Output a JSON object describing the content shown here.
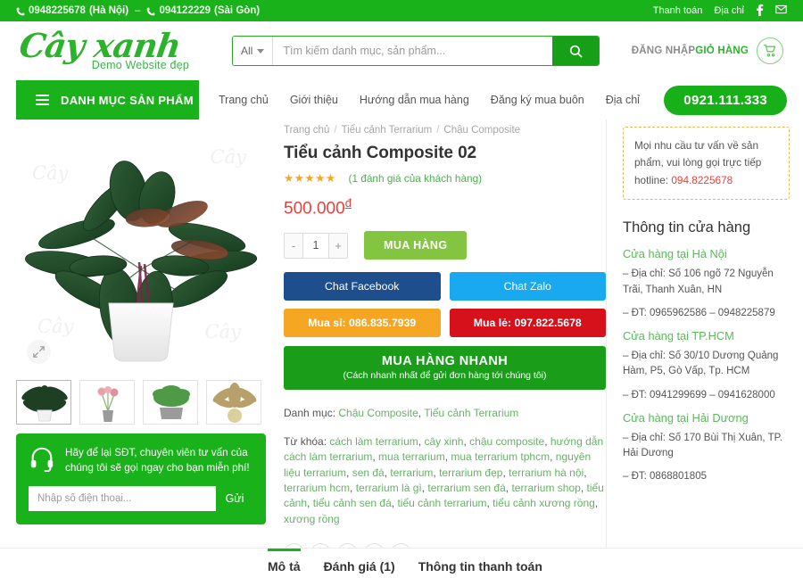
{
  "topbar": {
    "phone1": "0948225678",
    "loc1": "(Hà Nội)",
    "dash": "–",
    "phone2": "094122229",
    "loc2": "(Sài Gòn)",
    "links": [
      "Thanh toán",
      "Địa chỉ"
    ],
    "icons": [
      "facebook-icon",
      "mail-icon"
    ]
  },
  "header": {
    "logo_text": "Cây xanh",
    "logo_sub": "Demo Website đẹp",
    "search": {
      "category": "All",
      "placeholder": "Tìm kiếm danh mục, sản phẩm...",
      "value": ""
    },
    "login_label": "ĐĂNG NHẬP",
    "cart_label": "GIỎ HÀNG"
  },
  "nav": {
    "category_button": "DANH MỤC SẢN PHẨM",
    "links": [
      "Trang chủ",
      "Giới thiệu",
      "Hướng dẫn mua hàng",
      "Đăng ký mua buôn",
      "Địa chỉ"
    ],
    "hotline": "0921.111.333"
  },
  "product": {
    "breadcrumb": [
      "Trang chủ",
      "Tiểu cảnh Terrarium",
      "Chậu Composite"
    ],
    "title": "Tiểu cảnh Composite 02",
    "stars": "★★★★★",
    "review_link": "(1 đánh giá của khách hàng)",
    "price": "500.000",
    "currency": "đ",
    "qty_minus": "-",
    "qty_value": "1",
    "qty_plus": "+",
    "buy_label": "MUA HÀNG",
    "chat_facebook": "Chat Facebook",
    "chat_zalo": "Chat Zalo",
    "mua_si": "Mua sỉ: 086.835.7939",
    "mua_le": "Mua lẻ: 097.822.5678",
    "fast_title": "MUA HÀNG NHANH",
    "fast_sub": "(Cách nhanh nhất để gửi đơn hàng tới chúng tôi)",
    "category_label": "Danh mục:",
    "categories": [
      "Chậu Composite",
      "Tiểu cảnh Terrarium"
    ],
    "tags_label": "Từ khóa:",
    "tags": [
      "cách làm terrarium",
      "cây xinh",
      "chậu composite",
      "hướng dẫn cách làm terrarium",
      "mua terrarium",
      "mua terrarium tphcm",
      "nguyên liệu terrarium",
      "sen đá",
      "terrarium",
      "terrarium đẹp",
      "terrarium hà nội",
      "terrarium hcm",
      "terrarium là gì",
      "terrarium sen đá",
      "terrarium shop",
      "tiểu cảnh",
      "tiểu cảnh sen đá",
      "tiểu cảnh terrarium",
      "tiểu cảnh xương rồng",
      "xương rồng"
    ],
    "social_icons": [
      "facebook-icon",
      "twitter-icon",
      "mail-icon",
      "pinterest-icon",
      "linkedin-icon"
    ],
    "expand_icon": "expand-icon",
    "thumbnails": [
      "thumb-plant-1",
      "thumb-plant-2",
      "thumb-plant-3",
      "thumb-plant-4"
    ],
    "watermark": "Cây"
  },
  "callback": {
    "icon": "headset-icon",
    "text": "Hãy để lại SĐT, chuyên viên tư vấn của chúng tôi sẽ gọi ngay cho bạn miễn phí!",
    "placeholder": "Nhập số điện thoại...",
    "value": "",
    "submit": "Gửi"
  },
  "sidebar": {
    "hotline_text": "Mọi nhu cầu tư vấn về sản phẩm, vui lòng gọi trực tiếp hotline:",
    "hotline_number": "094.8225678",
    "store_title": "Thông tin cửa hàng",
    "stores": [
      {
        "name": "Cửa hàng tại Hà Nội",
        "address": "– Địa chỉ: Số 106 ngõ 72 Nguyễn Trãi, Thanh Xuân, HN",
        "phone": "– ĐT: 0965962586 – 0948225879"
      },
      {
        "name": "Cửa hàng tại TP.HCM",
        "address": "– Địa chỉ: Số 30/10 Dương Quảng Hàm, P5, Gò Vấp, Tp. HCM",
        "phone": "– ĐT: 0941299699 – 0941628000"
      },
      {
        "name": "Cửa hàng tại Hải Dương",
        "address": "– Địa chỉ: Số 170 Bùi Thị Xuân, TP. Hải Dương",
        "phone": "– ĐT: 0868801805"
      }
    ]
  },
  "tabs": {
    "items": [
      "Mô tả",
      "Đánh giá (1)",
      "Thông tin thanh toán"
    ],
    "active_index": 0
  },
  "colors": {
    "brand_green": "#1ab21a",
    "light_green": "#83c441",
    "price_red": "#e8413c",
    "facebook_blue": "#1f4e8c",
    "zalo_blue": "#18a9f0",
    "orange": "#f5a623",
    "red": "#d6111b",
    "star_gold": "#f5a623"
  }
}
